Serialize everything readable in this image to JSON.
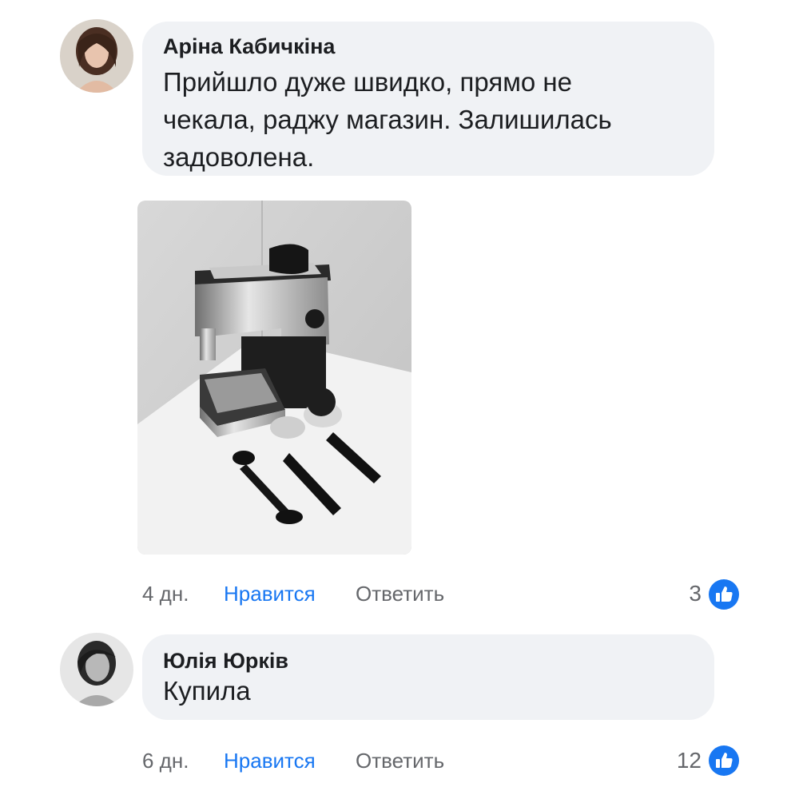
{
  "comments": [
    {
      "author": "Аріна Кабичкіна",
      "text_lines": [
        "Прийшло дуже швидко, прямо не",
        "чекала, раджу магазин. Залишилась",
        "задоволена."
      ],
      "time": "4 дн.",
      "like_label": "Нравится",
      "reply_label": "Ответить",
      "likes": "3",
      "has_photo": true
    },
    {
      "author": "Юлія Юрків",
      "text_lines": [
        "Купила"
      ],
      "time": "6 дн.",
      "like_label": "Нравится",
      "reply_label": "Ответить",
      "likes": "12"
    }
  ],
  "icons": {
    "like_badge": "thumbs-up-icon",
    "photo": "espresso-machine-photo"
  },
  "colors": {
    "bubble": "#f0f2f5",
    "link_blue": "#1877f2",
    "meta_gray": "#65676b",
    "text": "#1c1e21"
  }
}
